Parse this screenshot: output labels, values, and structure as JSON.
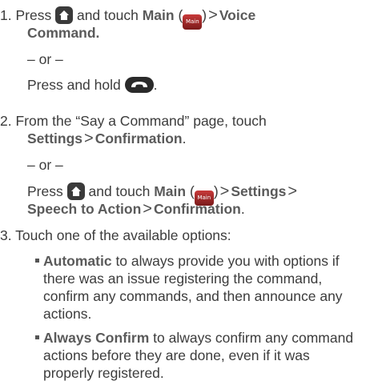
{
  "steps": [
    {
      "number": "1.",
      "part1": "Press",
      "part2": "and touch",
      "main_label": "Main",
      "main_icon_text": "Main",
      "voice": "Voice",
      "command": "Command.",
      "or": "– or –",
      "press_hold": "Press and hold"
    },
    {
      "number": "2.",
      "line1": "From the “Say a Command” page, touch",
      "settings": "Settings",
      "confirmation": "Confirmation",
      "or": "– or –",
      "press": "Press",
      "and_touch": "and touch",
      "main_label": "Main",
      "main_icon_text": "Main",
      "settings2": "Settings",
      "speech_to_action": "Speech to Action",
      "confirmation2": "Confirmation"
    },
    {
      "number": "3.",
      "line1": "Touch one of the available options:"
    }
  ],
  "options": [
    {
      "label": "Automatic",
      "lines": [
        "to always provide you with options if",
        "there was an issue registering the command,",
        "confirm any commands, and then announce any",
        "actions."
      ]
    },
    {
      "label": "Always Confirm",
      "lines": [
        "to always confirm any command",
        "actions before they are done, even if it was",
        "properly registered."
      ]
    }
  ]
}
